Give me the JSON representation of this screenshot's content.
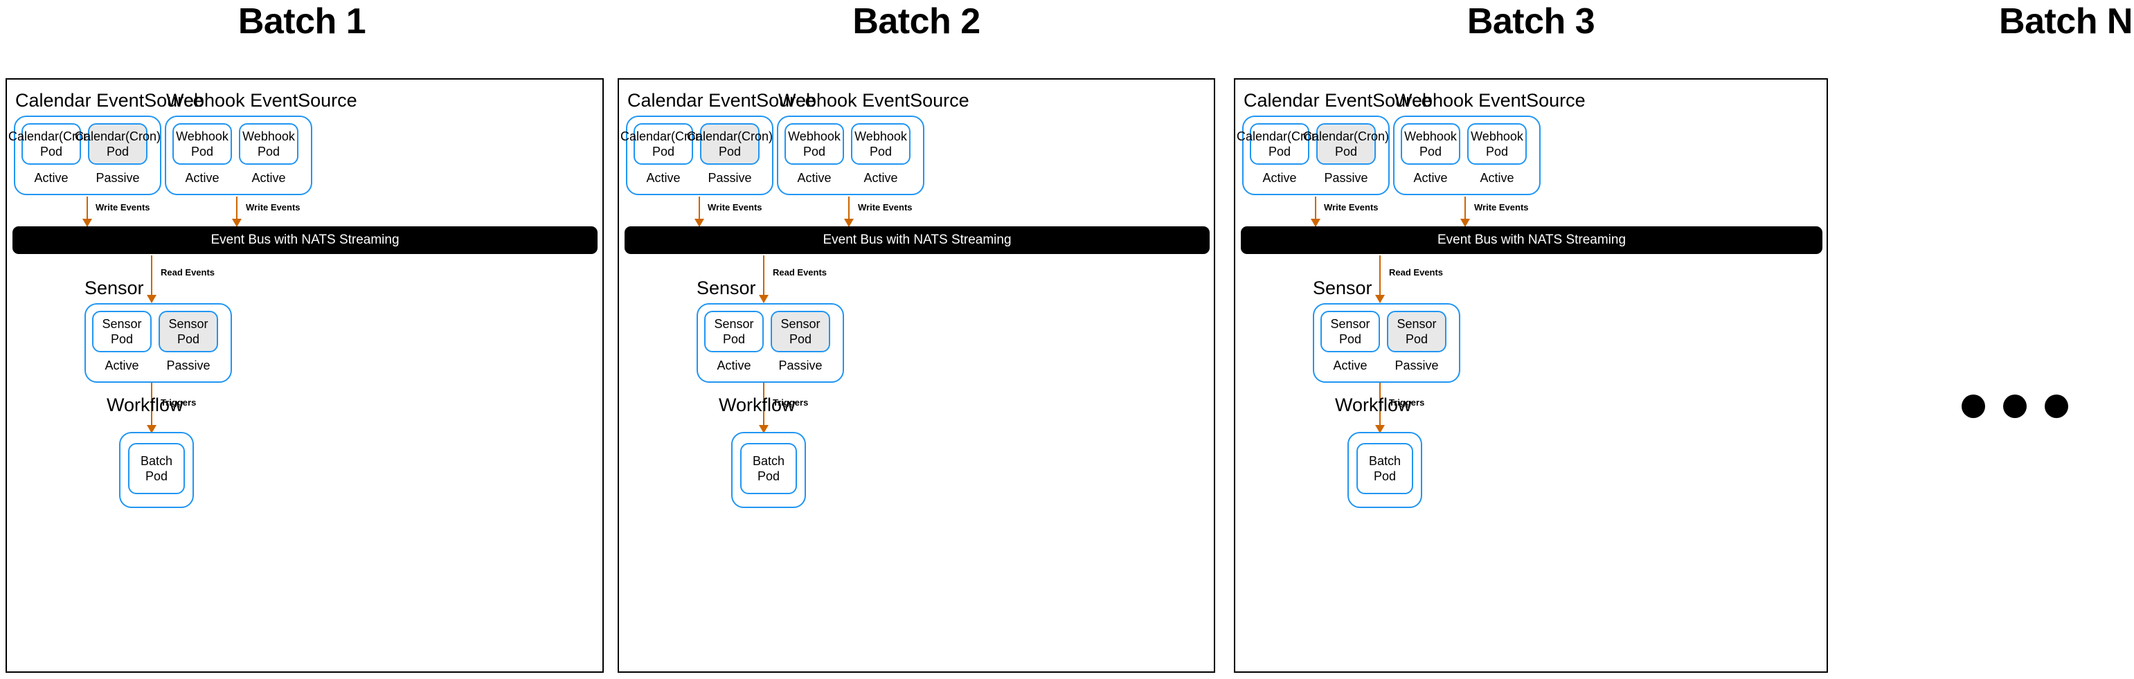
{
  "diagram": {
    "title_batch_1": "Batch 1",
    "title_batch_2": "Batch 2",
    "title_batch_3": "Batch 3",
    "title_batch_n": "Batch N",
    "labels": {
      "calendar_eventsource": "Calendar EventSource",
      "webhook_eventsource": "Webhook EventSource",
      "sensor": "Sensor",
      "workflow": "Workflow",
      "event_bus": "Event Bus with NATS Streaming",
      "write_events": "Write Events",
      "read_events": "Read Events",
      "triggers": "Triggers",
      "active": "Active",
      "passive": "Passive"
    },
    "pods": {
      "calendar_cron_pod_line1": "Calendar(Cron)",
      "calendar_cron_pod_line2": "Pod",
      "webhook_pod_line1": "Webhook",
      "webhook_pod_line2": "Pod",
      "sensor_pod_line1": "Sensor",
      "sensor_pod_line2": "Pod",
      "batch_pod_line1": "Batch",
      "batch_pod_line2": "Pod"
    },
    "colors": {
      "blue_border": "#2196F3",
      "passive_fill": "#E8E8E8",
      "arrow_orange": "#CC6600",
      "bus_black": "#000000",
      "panel_border": "#000000"
    },
    "ellipsis_dot_count": 3
  }
}
